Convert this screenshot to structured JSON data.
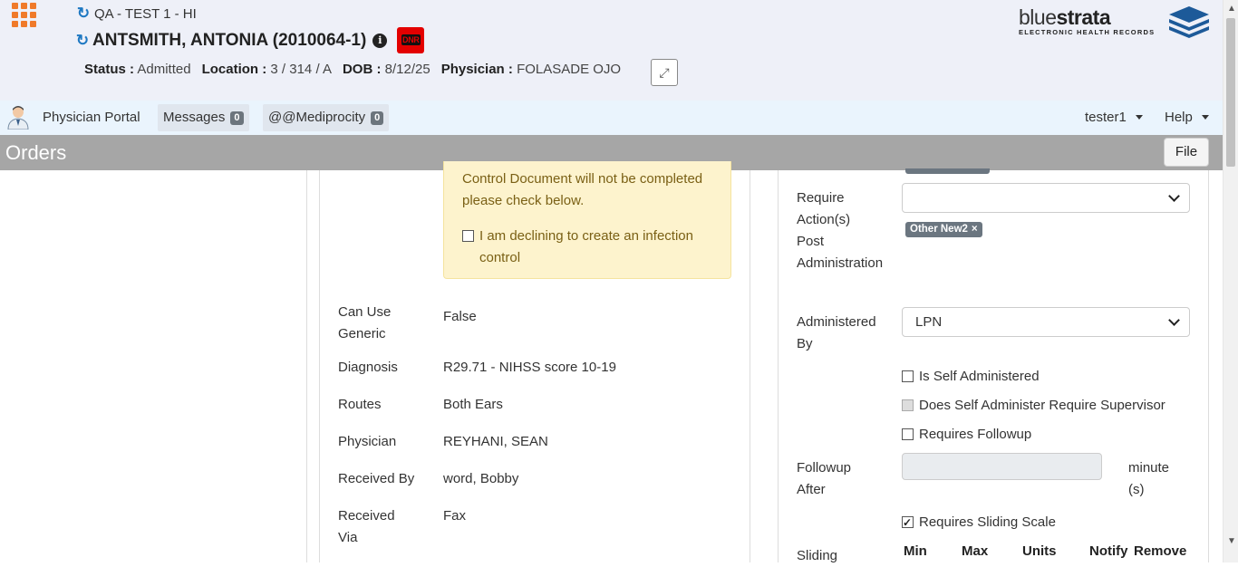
{
  "header": {
    "facility": "QA - TEST 1 - HI",
    "patient": "ANTSMITH, ANTONIA (2010064-1)",
    "dnr_label": "DNR",
    "status_label": "Status :",
    "status_value": "Admitted",
    "location_label": "Location :",
    "location_value": "3 / 314 / A",
    "dob_label": "DOB :",
    "dob_value": "8/12/25",
    "physician_label": "Physician :",
    "physician_value": "FOLASADE OJO",
    "logo_thin": "blue",
    "logo_bold": "strata",
    "logo_sub": "ELECTRONIC HEALTH RECORDS"
  },
  "nav": {
    "physician_portal": "Physician Portal",
    "messages": "Messages",
    "messages_count": "0",
    "mediprocity": "@@Mediprocity",
    "mediprocity_count": "0",
    "user": "tester1",
    "help": "Help"
  },
  "orders": {
    "title": "Orders",
    "file_button": "File"
  },
  "warning": {
    "text": "Control Document will not be completed please check below.",
    "checkbox_label": "I am declining to create an infection control"
  },
  "details": [
    {
      "label": "Can Use Generic",
      "value": "False"
    },
    {
      "label": "Diagnosis",
      "value": "R29.71 - NIHSS score 10-19"
    },
    {
      "label": "Routes",
      "value": "Both Ears"
    },
    {
      "label": "Physician",
      "value": "REYHANI, SEAN"
    },
    {
      "label": "Received By",
      "value": "word, Bobby"
    },
    {
      "label": "Received Via",
      "value": "Fax"
    }
  ],
  "right": {
    "require_actions_label": "Require Action(s) Post Administration",
    "require_actions_value": "",
    "tag": "Other New2",
    "tag_remove": "×",
    "administered_by_label": "Administered By",
    "administered_by_value": "LPN",
    "is_self_administered": "Is Self Administered",
    "self_admin_supervisor": "Does Self Administer Require Supervisor",
    "requires_followup": "Requires Followup",
    "followup_after_label": "Followup After",
    "followup_after_value": "",
    "followup_unit": "minute (s)",
    "requires_sliding_scale": "Requires Sliding Scale",
    "sliding_label": "Sliding",
    "columns": [
      "Min",
      "Max",
      "Units",
      "Notify",
      "Remove"
    ]
  },
  "colors": {
    "accent": "#1e78c2",
    "grid_icon": "#f07a2a",
    "warning_bg": "#fdf3cd",
    "orders_bar": "#a6a6a6"
  }
}
